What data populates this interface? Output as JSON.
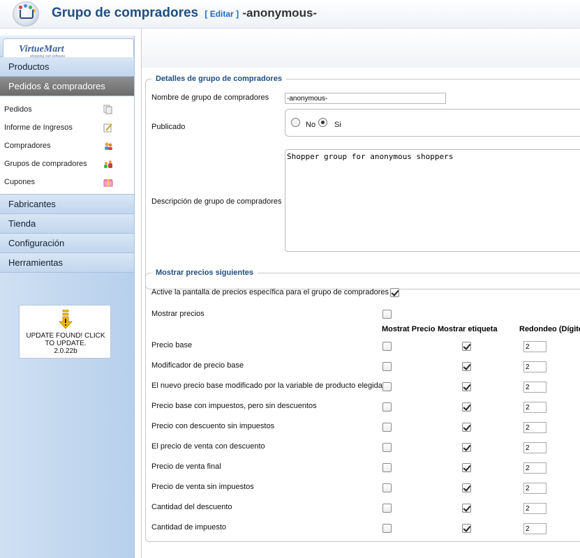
{
  "header": {
    "title": "Grupo de compradores",
    "edit_label": "[ Editar ]",
    "subtitle": "-anonymous-"
  },
  "sidebar": {
    "logo_name": "VirtueMart",
    "logo_tagline": "shopping cart software",
    "menu_top": [
      {
        "label": "Productos",
        "active": false
      },
      {
        "label": "Pedidos & compradores",
        "active": true
      }
    ],
    "submenu": [
      {
        "label": "Pedidos",
        "icon": "orders-icon"
      },
      {
        "label": "Informe de Ingresos",
        "icon": "report-icon"
      },
      {
        "label": "Compradores",
        "icon": "shoppers-icon"
      },
      {
        "label": "Grupos de compradores",
        "icon": "shopper-groups-icon"
      },
      {
        "label": "Cupones",
        "icon": "coupons-icon"
      }
    ],
    "menu_bottom": [
      {
        "label": "Fabricantes"
      },
      {
        "label": "Tienda"
      },
      {
        "label": "Configuración"
      },
      {
        "label": "Herramientas"
      }
    ],
    "update_notice": "UPDATE FOUND! CLICK TO UPDATE.",
    "update_version": "2.0.22b"
  },
  "details": {
    "legend": "Detalles de grupo de compradores",
    "name_label": "Nombre de grupo de compradores",
    "name_value": "-anonymous-",
    "published_label": "Publicado",
    "published_no": "No",
    "published_yes": "Si",
    "published_selected": "Si",
    "description_label": "Descripción de grupo de compradores",
    "description_value": "Shopper group for anonymous shoppers"
  },
  "prices": {
    "legend": "Mostrar precios siguientes",
    "activate_label": "Active la pantalla de precios específica para el grupo de compradores",
    "activate_checked": true,
    "show_prices_label": "Mostrar precios",
    "show_prices_checked": false,
    "col_show_price": "Mostrat Precio",
    "col_show_label": "Mostrar etiqueta",
    "col_rounding": "Redondeo (Dígitos)",
    "rows": [
      {
        "label": "Precio base",
        "show": false,
        "tag": true,
        "rounding": "2"
      },
      {
        "label": "Modificador de precio base",
        "show": false,
        "tag": true,
        "rounding": "2"
      },
      {
        "label": "El nuevo precio base modificado por la variable de producto elegida",
        "show": false,
        "tag": true,
        "rounding": "2"
      },
      {
        "label": "Precio base con impuestos, pero sin descuentos",
        "show": false,
        "tag": true,
        "rounding": "2"
      },
      {
        "label": "Precio con descuento sin impuestos",
        "show": false,
        "tag": true,
        "rounding": "2"
      },
      {
        "label": "El precio de venta con descuento",
        "show": false,
        "tag": true,
        "rounding": "2"
      },
      {
        "label": "Precio de venta final",
        "show": false,
        "tag": true,
        "rounding": "2"
      },
      {
        "label": "Precio de venta sin impuestos",
        "show": false,
        "tag": true,
        "rounding": "2"
      },
      {
        "label": "Cantidad del descuento",
        "show": false,
        "tag": true,
        "rounding": "2"
      },
      {
        "label": "Cantidad de impuesto",
        "show": false,
        "tag": true,
        "rounding": "2"
      }
    ]
  },
  "colors": {
    "title": "#1f4e84",
    "active_menu": "#7a7a7a",
    "sidebar": "#c2d6ee"
  }
}
